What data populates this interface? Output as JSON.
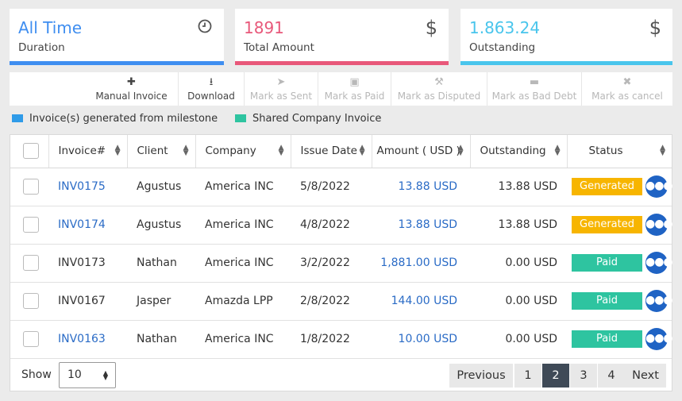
{
  "cards": [
    {
      "value": "All Time",
      "label": "Duration",
      "icon": "clock-icon",
      "glyph": "◷",
      "color": "#3f8ef0",
      "bar": "#3f8ef0"
    },
    {
      "value": "1891",
      "label": "Total Amount",
      "icon": "dollar-icon",
      "glyph": "$",
      "color": "#e8587a",
      "bar": "#e8587a"
    },
    {
      "value": "1.863.24",
      "label": "Outstanding",
      "icon": "dollar-icon",
      "glyph": "$",
      "color": "#49c5ec",
      "bar": "#49c5ec"
    }
  ],
  "toolbar": [
    {
      "label": "Manual Invoice",
      "icon": "plus-icon",
      "glyph": "✚",
      "enabled": true
    },
    {
      "label": "Download",
      "icon": "download-icon",
      "glyph": "⭳",
      "enabled": true
    },
    {
      "label": "Mark as Sent",
      "icon": "paper-plane-icon",
      "glyph": "➤",
      "enabled": false
    },
    {
      "label": "Mark as Paid",
      "icon": "money-bill-icon",
      "glyph": "▣",
      "enabled": false
    },
    {
      "label": "Mark as Disputed",
      "icon": "gavel-icon",
      "glyph": "⚒",
      "enabled": false
    },
    {
      "label": "Mark as Bad Debt",
      "icon": "credit-card-icon",
      "glyph": "▬",
      "enabled": false
    },
    {
      "label": "Mark as cancel",
      "icon": "x-icon",
      "glyph": "✖",
      "enabled": false
    }
  ],
  "legend": [
    {
      "label": "Invoice(s) generated from milestone",
      "color": "#2f9be8"
    },
    {
      "label": "Shared Company Invoice",
      "color": "#2ec4a0"
    }
  ],
  "table": {
    "columns": [
      "Invoice#",
      "Client",
      "Company",
      "Issue Date",
      "Amount ( USD )",
      "Outstanding",
      "Status"
    ],
    "rows": [
      {
        "invoice": "INV0175",
        "client": "Agustus",
        "company": "America INC",
        "date": "5/8/2022",
        "amount": "13.88 USD",
        "outstanding": "13.88 USD",
        "status": "Generated",
        "status_color": "#f7b500",
        "linked": true
      },
      {
        "invoice": "INV0174",
        "client": "Agustus",
        "company": "America INC",
        "date": "4/8/2022",
        "amount": "13.88 USD",
        "outstanding": "13.88 USD",
        "status": "Generated",
        "status_color": "#f7b500",
        "linked": true
      },
      {
        "invoice": "INV0173",
        "client": "Nathan",
        "company": "America INC",
        "date": "3/2/2022",
        "amount": "1,881.00 USD",
        "outstanding": "0.00 USD",
        "status": "Paid",
        "status_color": "#2ec4a0",
        "linked": false
      },
      {
        "invoice": "INV0167",
        "client": "Jasper",
        "company": "Amazda LPP",
        "date": "2/8/2022",
        "amount": "144.00 USD",
        "outstanding": "0.00 USD",
        "status": "Paid",
        "status_color": "#2ec4a0",
        "linked": false
      },
      {
        "invoice": "INV0163",
        "client": "Nathan",
        "company": "America INC",
        "date": "1/8/2022",
        "amount": "10.00 USD",
        "outstanding": "0.00 USD",
        "status": "Paid",
        "status_color": "#2ec4a0",
        "linked": true
      }
    ]
  },
  "footer": {
    "show_label": "Show",
    "page_size": "10",
    "pagination": [
      {
        "label": "Previous",
        "active": false
      },
      {
        "label": "1",
        "active": false
      },
      {
        "label": "2",
        "active": true
      },
      {
        "label": "3",
        "active": false
      },
      {
        "label": "4",
        "active": false
      },
      {
        "label": "Next",
        "active": false
      }
    ]
  }
}
